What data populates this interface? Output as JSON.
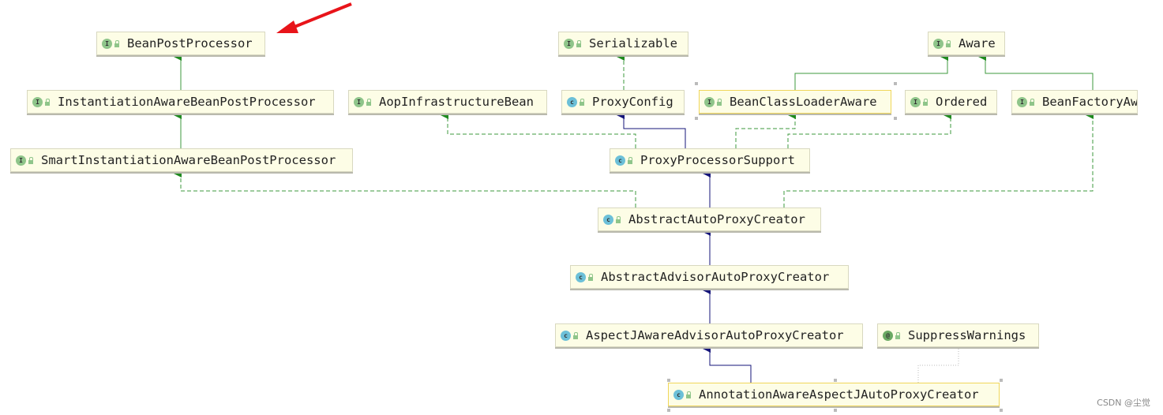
{
  "nodes": [
    {
      "id": "bpp",
      "label": "BeanPostProcessor",
      "kind": "interface",
      "icon": "I"
    },
    {
      "id": "iabpp",
      "label": "InstantiationAwareBeanPostProcessor",
      "kind": "interface",
      "icon": "I"
    },
    {
      "id": "siabpp",
      "label": "SmartInstantiationAwareBeanPostProcessor",
      "kind": "interface",
      "icon": "I"
    },
    {
      "id": "aop",
      "label": "AopInfrastructureBean",
      "kind": "interface",
      "icon": "I"
    },
    {
      "id": "ser",
      "label": "Serializable",
      "kind": "interface",
      "icon": "I"
    },
    {
      "id": "pc",
      "label": "ProxyConfig",
      "kind": "class",
      "icon": "c"
    },
    {
      "id": "bcla",
      "label": "BeanClassLoaderAware",
      "kind": "interface",
      "icon": "I"
    },
    {
      "id": "ord",
      "label": "Ordered",
      "kind": "interface",
      "icon": "I"
    },
    {
      "id": "bfa",
      "label": "BeanFactoryAw",
      "kind": "interface",
      "icon": "I"
    },
    {
      "id": "aware",
      "label": "Aware",
      "kind": "interface",
      "icon": "I"
    },
    {
      "id": "pps",
      "label": "ProxyProcessorSupport",
      "kind": "class",
      "icon": "c"
    },
    {
      "id": "aapc",
      "label": "AbstractAutoProxyCreator",
      "kind": "class",
      "icon": "c"
    },
    {
      "id": "aadv",
      "label": "AbstractAdvisorAutoProxyCreator",
      "kind": "class",
      "icon": "c"
    },
    {
      "id": "ajaa",
      "label": "AspectJAwareAdvisorAutoProxyCreator",
      "kind": "class",
      "icon": "c"
    },
    {
      "id": "sw",
      "label": "SuppressWarnings",
      "kind": "annotation",
      "icon": "@"
    },
    {
      "id": "aaaj",
      "label": "AnnotationAwareAspectJAutoProxyCreator",
      "kind": "class",
      "icon": "c"
    }
  ],
  "colors": {
    "extends": "#1a1a8c",
    "implements": "#2e8b2e",
    "annotation": "#b8b8b8",
    "highlight_arrow": "#e8141a",
    "node_bg": "#fdfde6"
  },
  "watermark": "CSDN @尘觉"
}
